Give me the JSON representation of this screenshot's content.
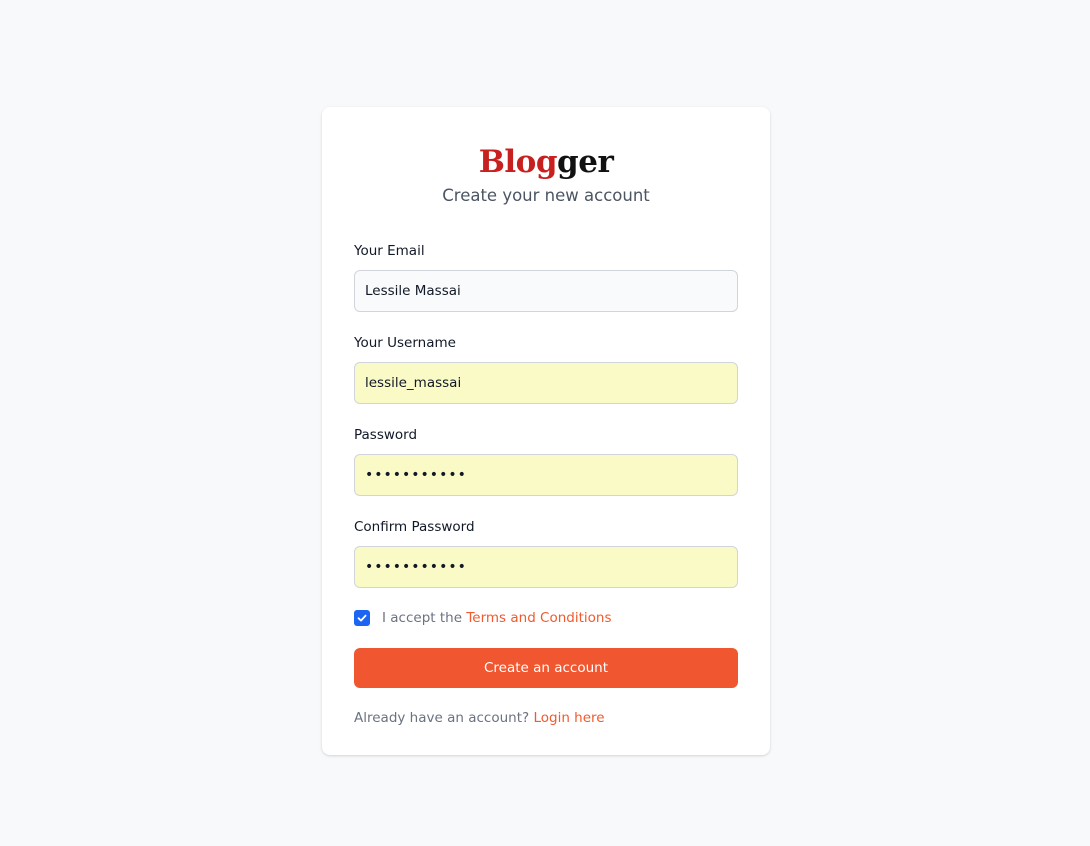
{
  "brand": {
    "part1": "Blog",
    "part2": "ger",
    "accent_color": "#c8201f"
  },
  "subtitle": "Create your new account",
  "form": {
    "email": {
      "label": "Your Email",
      "value": "Lessile Massai"
    },
    "username": {
      "label": "Your Username",
      "value": "lessile_massai"
    },
    "password": {
      "label": "Password",
      "value": "lessilepass"
    },
    "confirm_password": {
      "label": "Confirm Password",
      "value": "lessilepass"
    },
    "terms": {
      "checked": true,
      "prefix": "I accept the",
      "link_label": "Terms and Conditions"
    },
    "submit_label": "Create an account"
  },
  "footer": {
    "prompt": "Already have an account?",
    "link_label": "Login here"
  },
  "colors": {
    "primary": "#f0562f",
    "checkbox": "#1c64f2",
    "autofill_background": "#fafac6",
    "page_background": "#f8f9fb"
  },
  "icons": {
    "checkbox_mark": "check-icon"
  }
}
